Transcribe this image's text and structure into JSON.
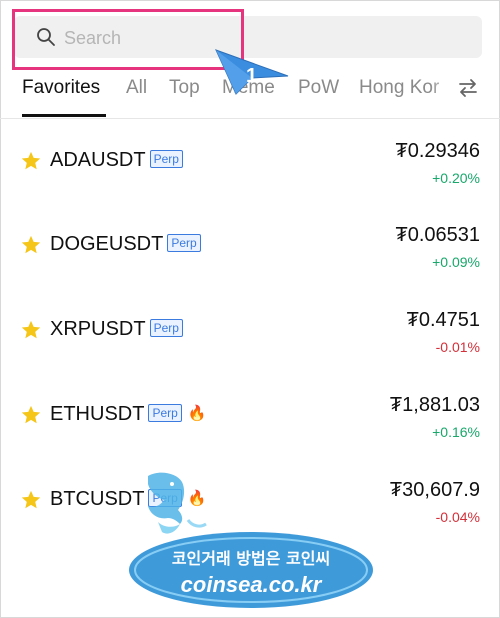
{
  "search": {
    "placeholder": "Search",
    "icon": "search-icon"
  },
  "step_badge": {
    "label": "1",
    "color": "#3b8de0"
  },
  "tabs": [
    {
      "label": "Favorites",
      "active": true
    },
    {
      "label": "All",
      "active": false
    },
    {
      "label": "Top",
      "active": false
    },
    {
      "label": "Meme",
      "active": false
    },
    {
      "label": "PoW",
      "active": false
    },
    {
      "label": "Hong Kor",
      "active": false
    }
  ],
  "tag_label": "Perp",
  "rows": [
    {
      "symbol": "ADAUSDT",
      "price": "₮0.29346",
      "change": "+0.20%",
      "hot": false,
      "direction": "up"
    },
    {
      "symbol": "DOGEUSDT",
      "price": "₮0.06531",
      "change": "+0.09%",
      "hot": false,
      "direction": "up"
    },
    {
      "symbol": "XRPUSDT",
      "price": "₮0.4751",
      "change": "-0.01%",
      "hot": false,
      "direction": "down"
    },
    {
      "symbol": "ETHUSDT",
      "price": "₮1,881.03",
      "change": "+0.16%",
      "hot": true,
      "direction": "up"
    },
    {
      "symbol": "BTCUSDT",
      "price": "₮30,607.9",
      "change": "-0.04%",
      "hot": true,
      "direction": "down"
    }
  ],
  "watermark": {
    "line1": "코인거래 방법은 코인씨",
    "line2": "coinsea.co.kr"
  },
  "colors": {
    "up": "#18a86b",
    "down": "#d4303a",
    "highlight": "#e7347f",
    "tag": "#3b7be0",
    "star": "#f5c518"
  }
}
